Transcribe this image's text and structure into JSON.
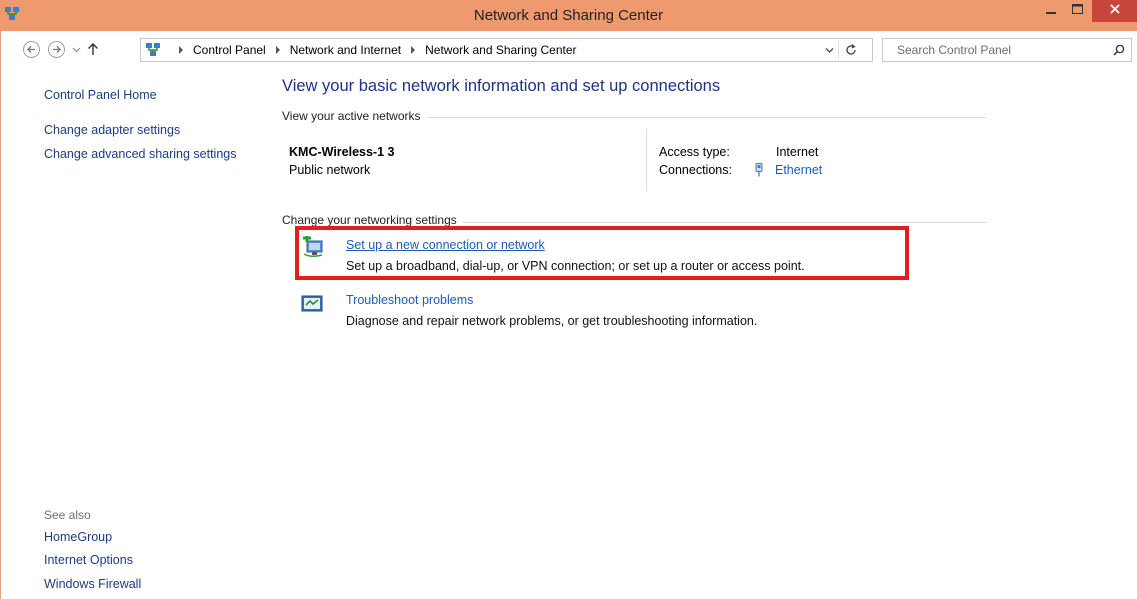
{
  "window": {
    "title": "Network and Sharing Center",
    "colors": {
      "titlebar": "#ee9a6e",
      "close_button": "#c7453a",
      "link": "#1c5cb7",
      "highlight": "#e0201c"
    }
  },
  "address_bar": {
    "breadcrumb": [
      "Control Panel",
      "Network and Internet",
      "Network and Sharing Center"
    ],
    "search_placeholder": "Search Control Panel"
  },
  "left_pane": {
    "links": [
      "Control Panel Home",
      "Change adapter settings",
      "Change advanced sharing settings"
    ],
    "see_also_label": "See also",
    "see_also_links": [
      "HomeGroup",
      "Internet Options",
      "Windows Firewall"
    ]
  },
  "main": {
    "heading": "View your basic network information and set up connections",
    "active_networks_label": "View your active networks",
    "network": {
      "name": "KMC-Wireless-1  3",
      "category": "Public network",
      "access_type_label": "Access type:",
      "access_type_value": "Internet",
      "connections_label": "Connections:",
      "connections_value": "Ethernet"
    },
    "change_settings_label": "Change your networking settings",
    "tasks": [
      {
        "title": "Set up a new connection or network",
        "description": "Set up a broadband, dial-up, or VPN connection; or set up a router or access point."
      },
      {
        "title": "Troubleshoot problems",
        "description": "Diagnose and repair network problems, or get troubleshooting information."
      }
    ]
  }
}
